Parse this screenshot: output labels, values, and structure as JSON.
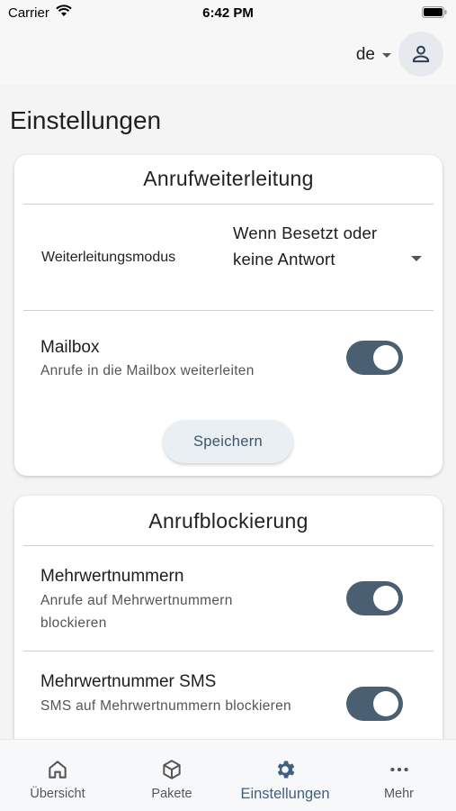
{
  "status_bar": {
    "carrier": "Carrier",
    "time": "6:42 PM"
  },
  "header": {
    "language": "de"
  },
  "page_title": "Einstellungen",
  "call_forwarding": {
    "title": "Anrufweiterleitung",
    "mode_label": "Weiterleitungsmodus",
    "mode_value": "Wenn Besetzt oder keine Antwort",
    "mailbox_title": "Mailbox",
    "mailbox_subtitle": "Anrufe in die Mailbox weiterleiten",
    "mailbox_enabled": true,
    "save_label": "Speichern"
  },
  "call_blocking": {
    "title": "Anrufblockierung",
    "items": [
      {
        "title": "Mehrwertnummern",
        "subtitle": "Anrufe auf Mehrwertnummern blockieren",
        "enabled": true
      },
      {
        "title": "Mehrwertnummer SMS",
        "subtitle": "SMS auf Mehrwertnummern blockieren",
        "enabled": true
      }
    ]
  },
  "bottom_nav": {
    "items": [
      {
        "label": "Übersicht",
        "icon": "home-icon"
      },
      {
        "label": "Pakete",
        "icon": "package-icon"
      },
      {
        "label": "Einstellungen",
        "icon": "gear-icon"
      },
      {
        "label": "Mehr",
        "icon": "more-dots-icon"
      }
    ],
    "active": "Einstellungen"
  },
  "colors": {
    "accent": "#41607f",
    "toggle_on": "#4b5f73",
    "button_bg": "#e9eff3"
  }
}
